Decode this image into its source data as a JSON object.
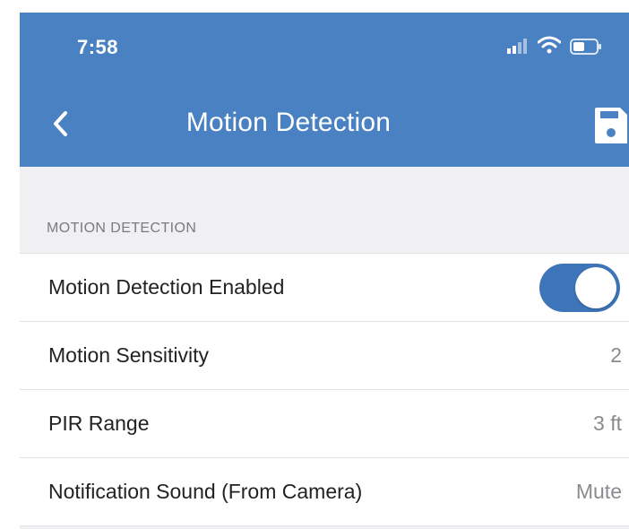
{
  "status_bar": {
    "time": "7:58",
    "icons": [
      "signal-icon",
      "wifi-icon",
      "battery-icon"
    ]
  },
  "nav": {
    "back_icon": "chevron-left-icon",
    "title": "Motion Detection",
    "save_icon": "save-icon"
  },
  "colors": {
    "header_bg": "#4a81c2",
    "toggle_on": "#3d75b8",
    "page_bg": "#f0f0f3"
  },
  "section": {
    "header": "MOTION DETECTION",
    "rows": [
      {
        "label": "Motion Detection Enabled",
        "type": "toggle",
        "toggle_on": true
      },
      {
        "label": "Motion Sensitivity",
        "value": "2"
      },
      {
        "label": "PIR Range",
        "value": "3 ft"
      },
      {
        "label": "Notification Sound (From Camera)",
        "value": "Mute"
      }
    ]
  }
}
